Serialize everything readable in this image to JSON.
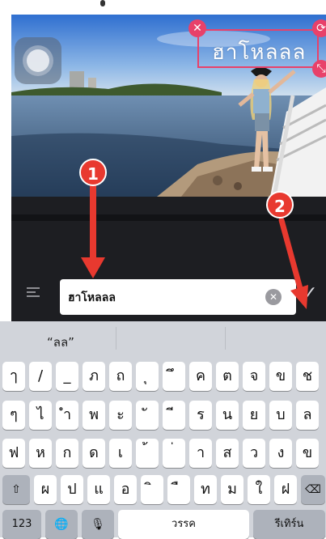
{
  "sticker": {
    "text": "ฮาโหลลล"
  },
  "editor": {
    "input_value": "ฮาโหลลล"
  },
  "callouts": [
    "1",
    "2"
  ],
  "suggestion": "“ลล”",
  "keyboard": {
    "row1": [
      "ๅ",
      "/",
      "_",
      "ภ",
      "ถ",
      "ุ",
      "ึ",
      "ค",
      "ต",
      "จ",
      "ข",
      "ช"
    ],
    "row2": [
      "ๆ",
      "ไ",
      "ำ",
      "พ",
      "ะ",
      "ั",
      "ี",
      "ร",
      "น",
      "ย",
      "บ",
      "ล"
    ],
    "row3": [
      "ฟ",
      "ห",
      "ก",
      "ด",
      "เ",
      "้",
      "่",
      "า",
      "ส",
      "ว",
      "ง",
      "ข"
    ],
    "row4": [
      "ผ",
      "ป",
      "แ",
      "อ",
      "ิ",
      "ื",
      "ท",
      "ม",
      "ใ",
      "ฝ"
    ],
    "num_label": "123",
    "space_label": "วรรค",
    "return_label": "รีเทิร์น",
    "shift_icon": "shift-icon",
    "globe_icon": "globe-icon",
    "mic_icon": "microphone-icon",
    "backspace_icon": "backspace-icon"
  },
  "colors": {
    "accent": "#e8416a",
    "callout": "#e8392f",
    "editor_bg": "#1d1e22",
    "keyboard_bg": "#d1d4da"
  }
}
